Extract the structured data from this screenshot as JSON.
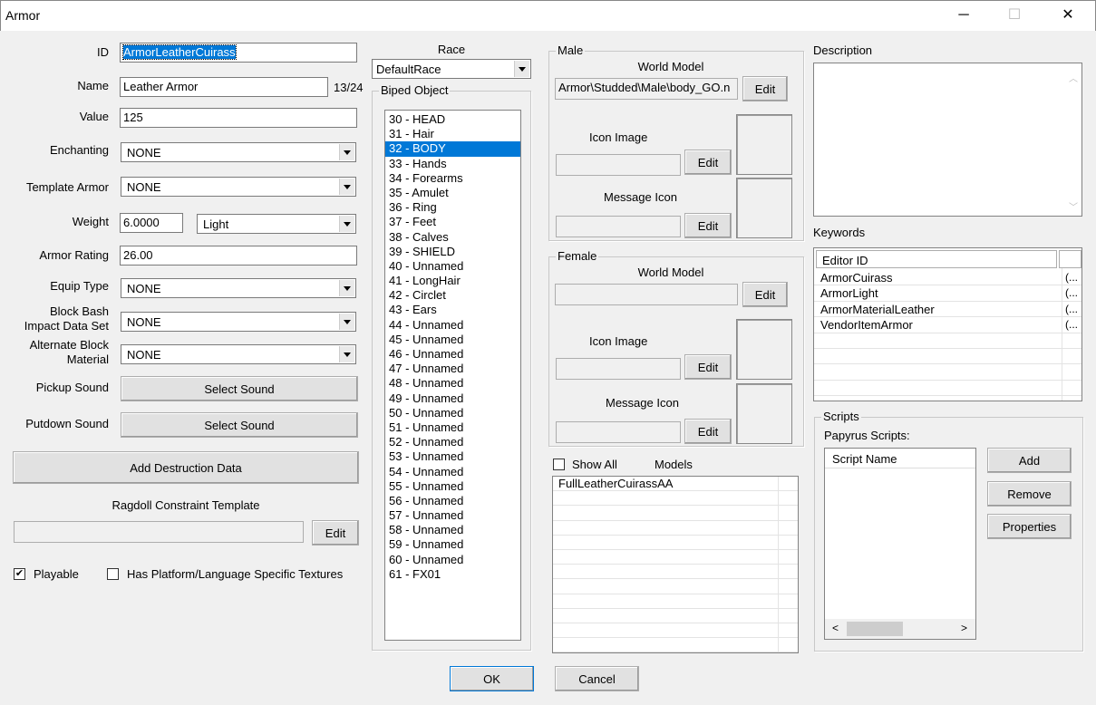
{
  "window": {
    "title": "Armor",
    "minimize": "─",
    "maximize": "☐",
    "close": "✕"
  },
  "form": {
    "id_label": "ID",
    "id_value": "ArmorLeatherCuirass",
    "name_label": "Name",
    "name_value": "Leather Armor",
    "name_count": "13/24",
    "value_label": "Value",
    "value_value": "125",
    "enchanting_label": "Enchanting",
    "enchanting_value": "NONE",
    "template_label": "Template Armor",
    "template_value": "NONE",
    "weight_label": "Weight",
    "weight_value": "6.0000",
    "weight_class": "Light",
    "rating_label": "Armor Rating",
    "rating_value": "26.00",
    "equip_label": "Equip Type",
    "equip_value": "NONE",
    "bash_label_1": "Block Bash",
    "bash_label_2": "Impact Data Set",
    "bash_value": "NONE",
    "altblock_label_1": "Alternate Block",
    "altblock_label_2": "Material",
    "altblock_value": "NONE",
    "pickup_label": "Pickup Sound",
    "pickup_button": "Select Sound",
    "putdown_label": "Putdown Sound",
    "putdown_button": "Select Sound",
    "destruction_button": "Add Destruction Data",
    "ragdoll_label": "Ragdoll Constraint Template",
    "ragdoll_edit": "Edit",
    "playable_label": "Playable",
    "playable_checked": true,
    "platform_label": "Has Platform/Language Specific Textures",
    "platform_checked": false
  },
  "race": {
    "label": "Race",
    "value": "DefaultRace"
  },
  "biped": {
    "label": "Biped Object",
    "items": [
      "30 - HEAD",
      "31 - Hair",
      "32 - BODY",
      "33 - Hands",
      "34 - Forearms",
      "35 - Amulet",
      "36 - Ring",
      "37 - Feet",
      "38 - Calves",
      "39 - SHIELD",
      "40 - Unnamed",
      "41 - LongHair",
      "42 - Circlet",
      "43 - Ears",
      "44 - Unnamed",
      "45 - Unnamed",
      "46 - Unnamed",
      "47 - Unnamed",
      "48 - Unnamed",
      "49 - Unnamed",
      "50 - Unnamed",
      "51 - Unnamed",
      "52 - Unnamed",
      "53 - Unnamed",
      "54 - Unnamed",
      "55 - Unnamed",
      "56 - Unnamed",
      "57 - Unnamed",
      "58 - Unnamed",
      "59 - Unnamed",
      "60 - Unnamed",
      "61 - FX01"
    ],
    "selected": "32 - BODY"
  },
  "male": {
    "label": "Male",
    "world_model_label": "World Model",
    "world_model_value": "Armor\\Studded\\Male\\body_GO.n",
    "edit": "Edit",
    "icon_label": "Icon Image",
    "message_label": "Message Icon"
  },
  "female": {
    "label": "Female",
    "world_model_label": "World Model",
    "world_model_value": "",
    "edit": "Edit",
    "icon_label": "Icon Image",
    "message_label": "Message Icon"
  },
  "models": {
    "show_all_label": "Show All",
    "label": "Models",
    "items": [
      "FullLeatherCuirassAA"
    ]
  },
  "description": {
    "label": "Description",
    "value": ""
  },
  "keywords": {
    "label": "Keywords",
    "column": "Editor ID",
    "items": [
      {
        "id": "ArmorCuirass",
        "extra": "(..."
      },
      {
        "id": "ArmorLight",
        "extra": "(..."
      },
      {
        "id": "ArmorMaterialLeather",
        "extra": "(..."
      },
      {
        "id": "VendorItemArmor",
        "extra": "(..."
      }
    ]
  },
  "scripts": {
    "group_label": "Scripts",
    "papyrus_label": "Papyrus Scripts:",
    "column": "Script Name",
    "add": "Add",
    "remove": "Remove",
    "properties": "Properties"
  },
  "dialog": {
    "ok": "OK",
    "cancel": "Cancel"
  },
  "colors": {
    "selection": "#0078d7",
    "background": "#f0f0f0"
  }
}
